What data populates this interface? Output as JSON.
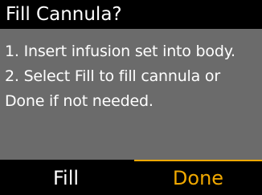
{
  "dialog": {
    "title": "Fill Cannula?",
    "message_lines": [
      "1. Insert infusion set into body.",
      "2. Select Fill to fill cannula or",
      "Done if not needed."
    ]
  },
  "softkeys": {
    "fill_label": "Fill",
    "done_label": "Done",
    "selected": "Done"
  },
  "colors": {
    "background": "#000000",
    "panel": "#6b6b6b",
    "text": "#ffffff",
    "highlight": "#f0a800"
  }
}
